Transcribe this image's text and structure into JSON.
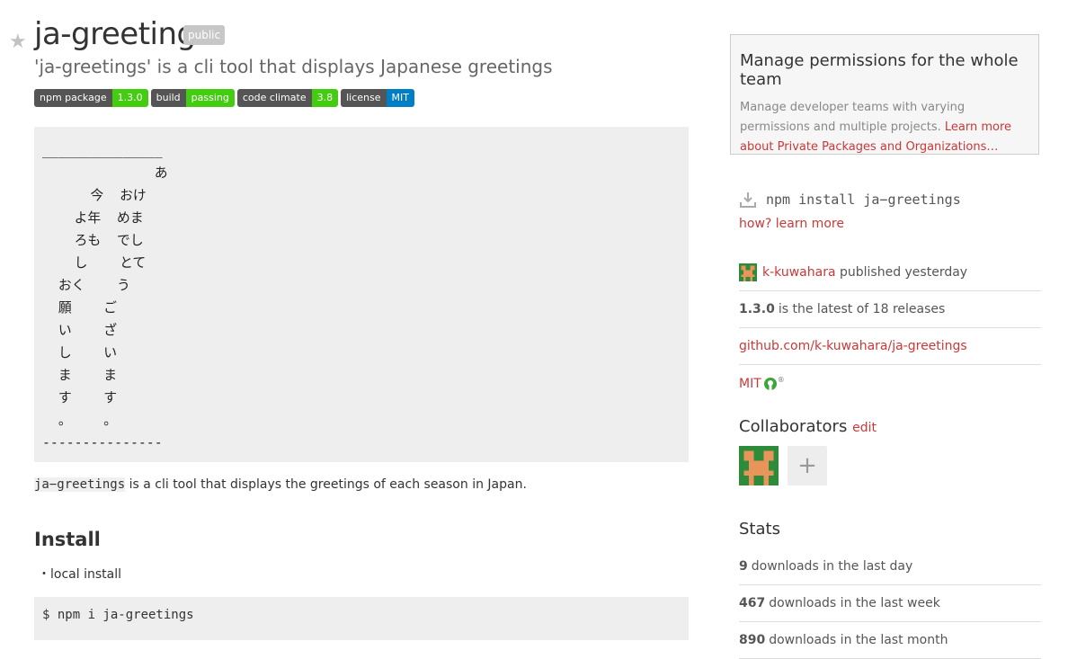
{
  "package": {
    "name": "ja-greetings",
    "visibility": "public",
    "description": "'ja-greetings' is a cli tool that displays Japanese greetings"
  },
  "badges": [
    {
      "label": "npm package",
      "value": "1.3.0",
      "color": "#4c1"
    },
    {
      "label": "build",
      "value": "passing",
      "color": "#4c1"
    },
    {
      "label": "code climate",
      "value": "3.8",
      "color": "#4c1"
    },
    {
      "label": "license",
      "value": "MIT",
      "color": "#007ec6"
    }
  ],
  "readme": {
    "ascii_art": "_______________\n              あ\n      今  おけ\n    よ年  めま\n    ろも  でし\n    し    とて\n  おく    う\n  願    ご\n  い    ざ\n  し    い\n  ま    ま\n  す    す\n  。    。\n---------------",
    "summary_code": "ja−greetings",
    "summary_text": " is a cli tool that displays the greetings of each season in Japan.",
    "install_heading": "Install",
    "install_item": "・local install",
    "install_command": "$ npm i ja-greetings"
  },
  "sidebar": {
    "promo_title": "Manage permissions for the whole team",
    "promo_text": "Manage developer teams with varying permissions and multiple projects. ",
    "promo_link": "Learn more about Private Packages and Organizations…",
    "install_cmd": "npm install ja−greetings",
    "how_link": "how? learn more",
    "publisher": "k-kuwahara",
    "published_text": " published yesterday",
    "version": "1.3.0",
    "version_text": " is the latest of 18 releases",
    "repo": "github.com/k-kuwahara/ja-greetings",
    "license": "MIT",
    "collaborators_heading": "Collaborators",
    "collaborators_edit": "edit",
    "add_collaborator": "+",
    "stats_heading": "Stats",
    "stats": [
      {
        "count": "9",
        "text": " downloads in the last day"
      },
      {
        "count": "467",
        "text": " downloads in the last week"
      },
      {
        "count": "890",
        "text": " downloads in the last month"
      }
    ]
  },
  "icons": {
    "star": "star-icon",
    "download": "download-icon",
    "osi": "open-source-icon"
  },
  "colors": {
    "link": "#cb3837",
    "avatar_bg": "#2e8b3a",
    "avatar_fg": "#e8945a"
  }
}
